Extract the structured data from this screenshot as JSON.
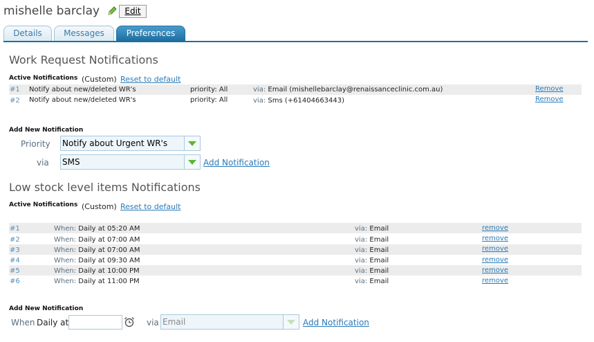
{
  "header": {
    "user_name": "mishelle barclay",
    "edit_label": "Edit"
  },
  "tabs": [
    {
      "label": "Details"
    },
    {
      "label": "Messages"
    },
    {
      "label": "Preferences"
    }
  ],
  "work_request": {
    "heading": "Work Request Notifications",
    "active_label": "Active Notifications",
    "custom_label": "(Custom)",
    "reset_label": "Reset to default",
    "items": [
      {
        "num": "#1",
        "desc": "Notify about new/deleted WR's",
        "priority_label": "priority:",
        "priority": "All",
        "via_label": "via:",
        "via": "Email (mishellebarclay@renaissanceclinic.com.au)",
        "remove": "Remove"
      },
      {
        "num": "#2",
        "desc": "Notify about new/deleted WR's",
        "priority_label": "priority:",
        "priority": "All",
        "via_label": "via:",
        "via": "Sms (+61404663443)",
        "remove": "Remove"
      }
    ],
    "add_title": "Add New Notification",
    "priority_label": "Priority",
    "priority_value": "Notify about Urgent WR's",
    "via_label": "via",
    "via_value": "SMS",
    "add_link": "Add Notification"
  },
  "low_stock": {
    "heading": "Low stock level items Notifications",
    "active_label": "Active Notifications",
    "custom_label": "(Custom)",
    "reset_label": "Reset to default",
    "items": [
      {
        "num": "#1",
        "when_label": "When:",
        "when": "Daily at 05:20 AM",
        "via_label": "via:",
        "via": "Email",
        "remove": "remove"
      },
      {
        "num": "#2",
        "when_label": "When:",
        "when": "Daily at 07:00 AM",
        "via_label": "via:",
        "via": "Email",
        "remove": "remove"
      },
      {
        "num": "#3",
        "when_label": "When:",
        "when": "Daily at 07:00 AM",
        "via_label": "via:",
        "via": "Email",
        "remove": "remove"
      },
      {
        "num": "#4",
        "when_label": "When:",
        "when": "Daily at 09:30 AM",
        "via_label": "via:",
        "via": "Email",
        "remove": "remove"
      },
      {
        "num": "#5",
        "when_label": "When:",
        "when": "Daily at 10:00 PM",
        "via_label": "via:",
        "via": "Email",
        "remove": "remove"
      },
      {
        "num": "#6",
        "when_label": "When:",
        "when": "Daily at 11:00 PM",
        "via_label": "via:",
        "via": "Email",
        "remove": "remove"
      }
    ],
    "add_title": "Add New Notification",
    "when_label": "When",
    "daily_label": "Daily at",
    "time_value": "",
    "via_label": "via",
    "via_value": "Email",
    "add_link": "Add Notification"
  }
}
